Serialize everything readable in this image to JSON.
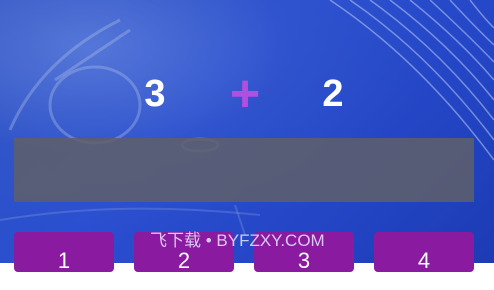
{
  "problem": {
    "operand_a": "3",
    "operator": "+",
    "operand_b": "2"
  },
  "answer": {
    "value": ""
  },
  "choices": [
    {
      "label": "1"
    },
    {
      "label": "2"
    },
    {
      "label": "3"
    },
    {
      "label": "4"
    }
  ],
  "watermark": {
    "text": "飞下载 • BYFZXY.COM"
  },
  "colors": {
    "background": "#2a4fd0",
    "operator": "#b04fe0",
    "choice_button": "#8a1aa0",
    "answer_box": "#5f5f69"
  }
}
